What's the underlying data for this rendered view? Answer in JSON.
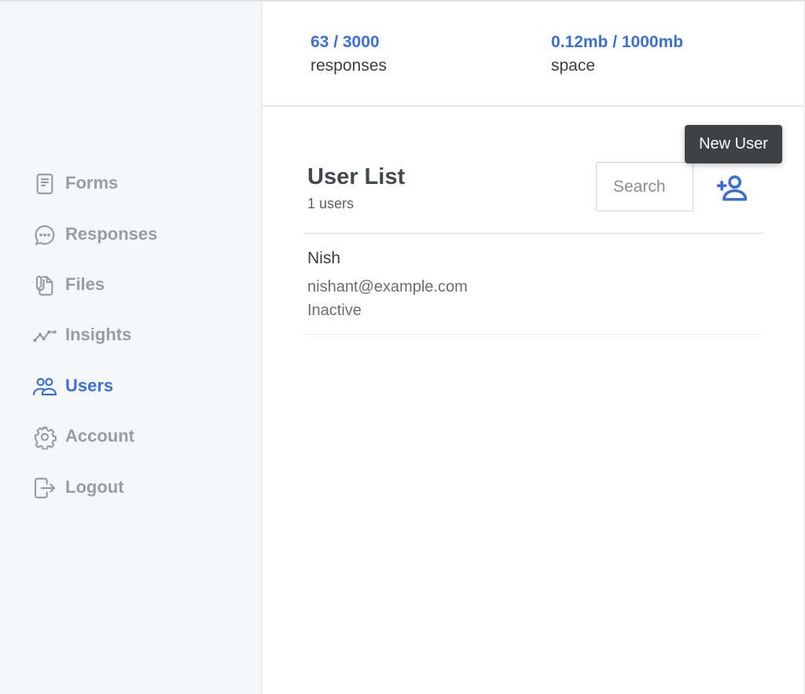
{
  "colors": {
    "accent": "#3c6fd1",
    "sidebar_bg": "#f6f7f9",
    "nav_inactive": "#9a9c9f",
    "tooltip_bg": "#3e4245"
  },
  "sidebar": {
    "items": [
      {
        "label": "Forms",
        "icon": "document-icon",
        "active": false
      },
      {
        "label": "Responses",
        "icon": "chat-bubble-icon",
        "active": false
      },
      {
        "label": "Files",
        "icon": "paperclip-file-icon",
        "active": false
      },
      {
        "label": "Insights",
        "icon": "line-chart-icon",
        "active": false
      },
      {
        "label": "Users",
        "icon": "users-icon",
        "active": true
      },
      {
        "label": "Account",
        "icon": "gear-icon",
        "active": false
      },
      {
        "label": "Logout",
        "icon": "logout-icon",
        "active": false
      }
    ]
  },
  "stats": {
    "responses": {
      "value": "63 / 3000",
      "caption": "responses"
    },
    "space": {
      "value": "0.12mb / 1000mb",
      "caption": "space"
    }
  },
  "user_list": {
    "title": "User List",
    "count": "1 users",
    "search_placeholder": "Search",
    "new_user_tooltip": "New User",
    "new_user_icon": "add-user-icon",
    "users": [
      {
        "name": "Nish",
        "email": "nishant@example.com",
        "status": "Inactive"
      }
    ]
  }
}
